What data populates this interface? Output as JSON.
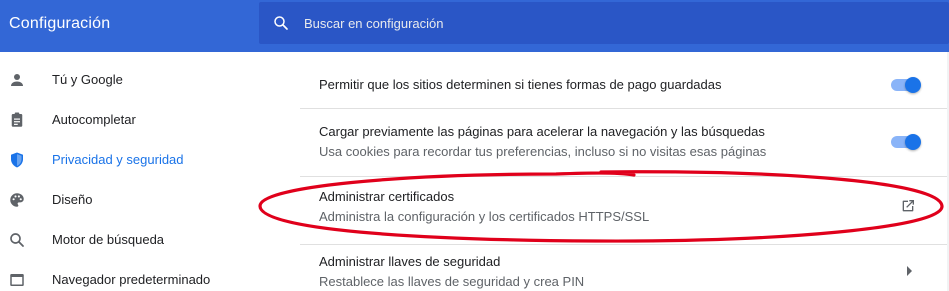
{
  "header": {
    "title": "Configuración",
    "search_placeholder": "Buscar en configuración",
    "colors": {
      "topbar": "#3367d6",
      "search_bg": "#2a56c6"
    }
  },
  "sidebar": {
    "items": [
      {
        "label": "Tú y Google",
        "icon": "person-icon",
        "active": false
      },
      {
        "label": "Autocompletar",
        "icon": "clipboard-icon",
        "active": false
      },
      {
        "label": "Privacidad y seguridad",
        "icon": "shield-icon",
        "active": true
      },
      {
        "label": "Diseño",
        "icon": "palette-icon",
        "active": false
      },
      {
        "label": "Motor de búsqueda",
        "icon": "search-icon",
        "active": false
      },
      {
        "label": "Navegador predeterminado",
        "icon": "browser-icon",
        "active": false
      }
    ],
    "active_color": "#1a73e8"
  },
  "settings": {
    "rows": [
      {
        "primary": "Permitir que los sitios determinen si tienes formas de pago guardadas",
        "control": "toggle",
        "enabled": true
      },
      {
        "primary": "Cargar previamente las páginas para acelerar la navegación y las búsquedas",
        "secondary": "Usa cookies para recordar tus preferencias, incluso si no visitas esas páginas",
        "control": "toggle",
        "enabled": true
      },
      {
        "primary": "Administrar certificados",
        "secondary": "Administra la configuración y los certificados HTTPS/SSL",
        "control": "external-link-icon",
        "highlighted": true
      },
      {
        "primary": "Administrar llaves de seguridad",
        "secondary": "Restablece las llaves de seguridad y crea PIN",
        "control": "chevron-right-icon"
      }
    ],
    "toggle_color": "#1a73e8",
    "highlight_color": "#e0001b"
  }
}
